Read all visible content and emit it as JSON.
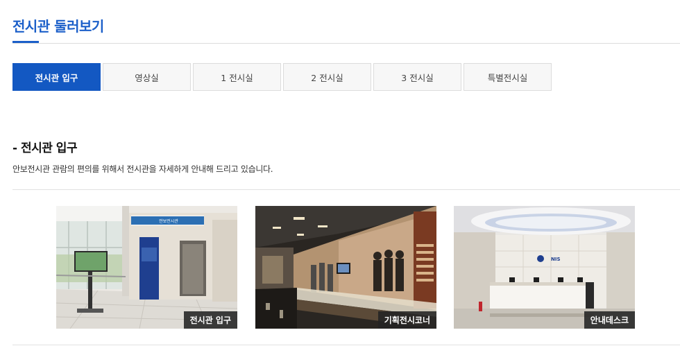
{
  "header": {
    "title": "전시관 둘러보기"
  },
  "tabs": [
    {
      "label": "전시관 입구",
      "active": true
    },
    {
      "label": "영상실",
      "active": false
    },
    {
      "label": "1 전시실",
      "active": false
    },
    {
      "label": "2 전시실",
      "active": false
    },
    {
      "label": "3 전시실",
      "active": false
    },
    {
      "label": "특별전시실",
      "active": false
    }
  ],
  "section": {
    "heading": "- 전시관 입구",
    "description": "안보전시관 관람의 편의를 위해서 전시관을 자세하게 안내해 드리고 있습니다."
  },
  "gallery": [
    {
      "caption": "전시관 입구",
      "image": "entrance-photo"
    },
    {
      "caption": "기획전시코너",
      "image": "exhibition-corner-photo"
    },
    {
      "caption": "안내데스크",
      "image": "info-desk-photo"
    }
  ],
  "colors": {
    "accent": "#1b5fc9",
    "active_tab": "#1358c2"
  }
}
